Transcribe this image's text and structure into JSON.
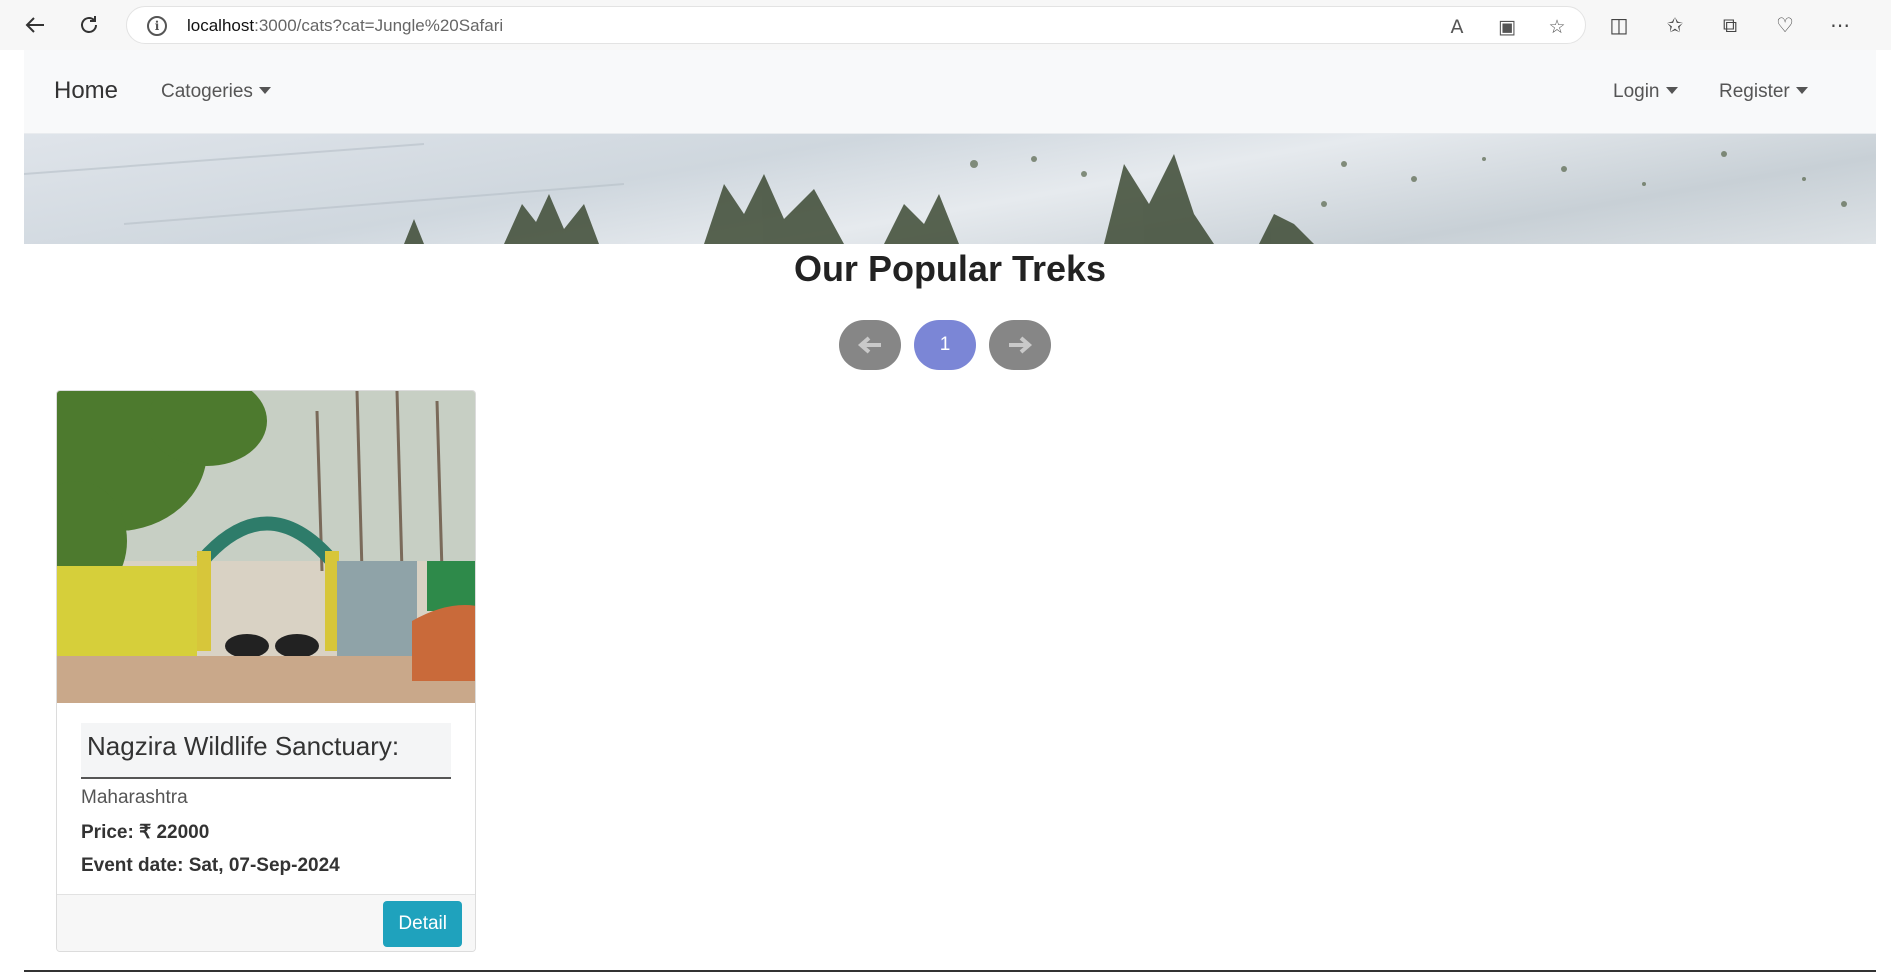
{
  "browser": {
    "url_host": "localhost",
    "url_rest": ":3000/cats?cat=Jungle%20Safari"
  },
  "navbar": {
    "brand": "Home",
    "categories_label": "Catogeries",
    "login_label": "Login",
    "register_label": "Register"
  },
  "main": {
    "heading": "Our Popular Treks",
    "pagination": {
      "prev_icon": "arrow-left-icon",
      "current_page": "1",
      "next_icon": "arrow-right-icon"
    }
  },
  "cards": [
    {
      "title": "Nagzira Wildlife Sanctuary:",
      "state": "Maharashtra",
      "price_label": "Price: ₹ 22000",
      "date_label": "Event date: Sat, 07-Sep-2024",
      "button_label": "Detail"
    }
  ],
  "colors": {
    "pager_gray": "#868686",
    "pager_active": "#7b86d6",
    "detail_button": "#1fa2bd"
  }
}
